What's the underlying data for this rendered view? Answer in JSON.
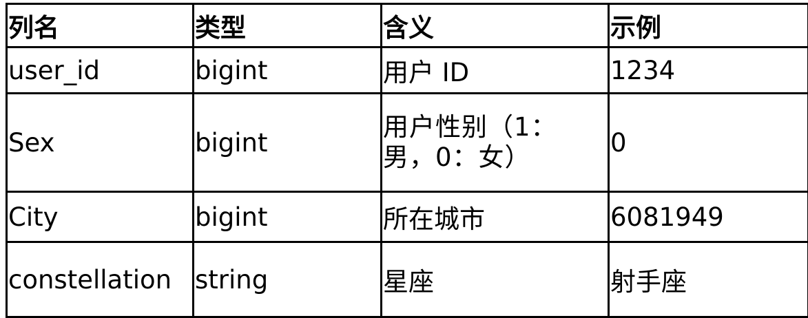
{
  "table": {
    "headers": [
      "列名",
      "类型",
      "含义",
      "示例"
    ],
    "rows": [
      [
        "user_id",
        "bigint",
        "用户 ID",
        "1234"
      ],
      [
        "Sex",
        "bigint",
        "用户性别（1：男，0：女）",
        "0"
      ],
      [
        "City",
        "bigint",
        "所在城市",
        "6081949"
      ],
      [
        "constellation",
        "string",
        "星座",
        "射手座"
      ]
    ]
  }
}
